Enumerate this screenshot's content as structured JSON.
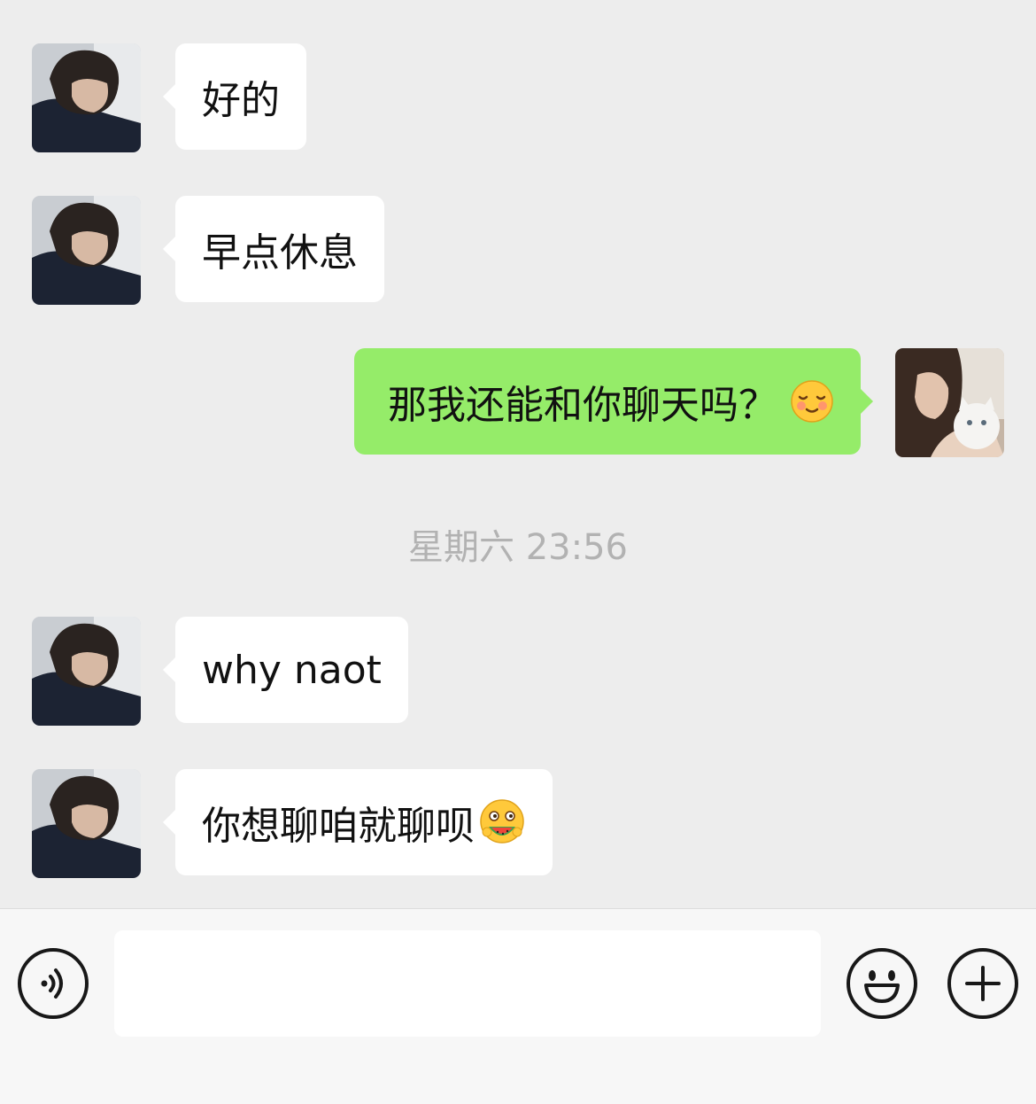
{
  "messages": [
    {
      "sender": "contact",
      "text": "好的"
    },
    {
      "sender": "contact",
      "text": "早点休息"
    },
    {
      "sender": "me",
      "text": "那我还能和你聊天吗？",
      "emoji": "shy-smile-emoji"
    },
    {
      "sender": "contact",
      "text": "why naot"
    },
    {
      "sender": "contact",
      "text": "你想聊咱就聊呗",
      "emoji": "eating-watermelon-emoji"
    }
  ],
  "timestamp": "星期六 23:56",
  "input_bar": {
    "text_value": "",
    "voice_icon": "voice-icon",
    "emoji_icon": "emoji-icon",
    "more_icon": "plus-icon"
  },
  "colors": {
    "background": "#ededed",
    "incoming_bubble": "#ffffff",
    "outgoing_bubble": "#95ec69",
    "timestamp_text": "#b2b2b2"
  }
}
